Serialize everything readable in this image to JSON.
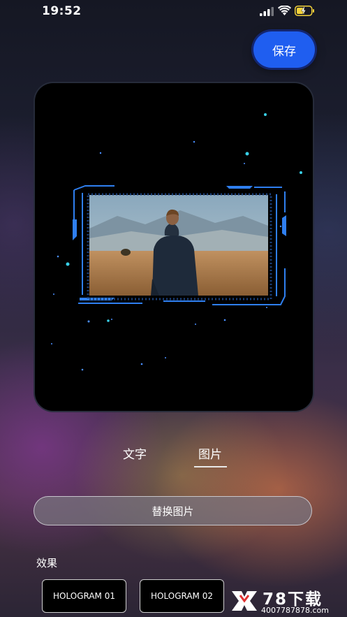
{
  "status_bar": {
    "time": "19:52"
  },
  "toolbar": {
    "save_label": "保存"
  },
  "tabs": [
    {
      "label": "文字"
    },
    {
      "label": "图片",
      "selected": true
    }
  ],
  "replace_button": {
    "label": "替换图片"
  },
  "effects": {
    "label": "效果",
    "items": [
      {
        "label": "HOLOGRAM 01"
      },
      {
        "label": "HOLOGRAM 02"
      }
    ]
  },
  "watermark": {
    "title": "78下载",
    "url": "4007787878.com"
  },
  "colors": {
    "accent": "#1f5ef0",
    "hologram": "#2f7ff0",
    "particle": "#38d0e8"
  },
  "icons": {
    "signal": "signal-icon",
    "wifi": "wifi-icon",
    "battery": "battery-charging-icon"
  }
}
